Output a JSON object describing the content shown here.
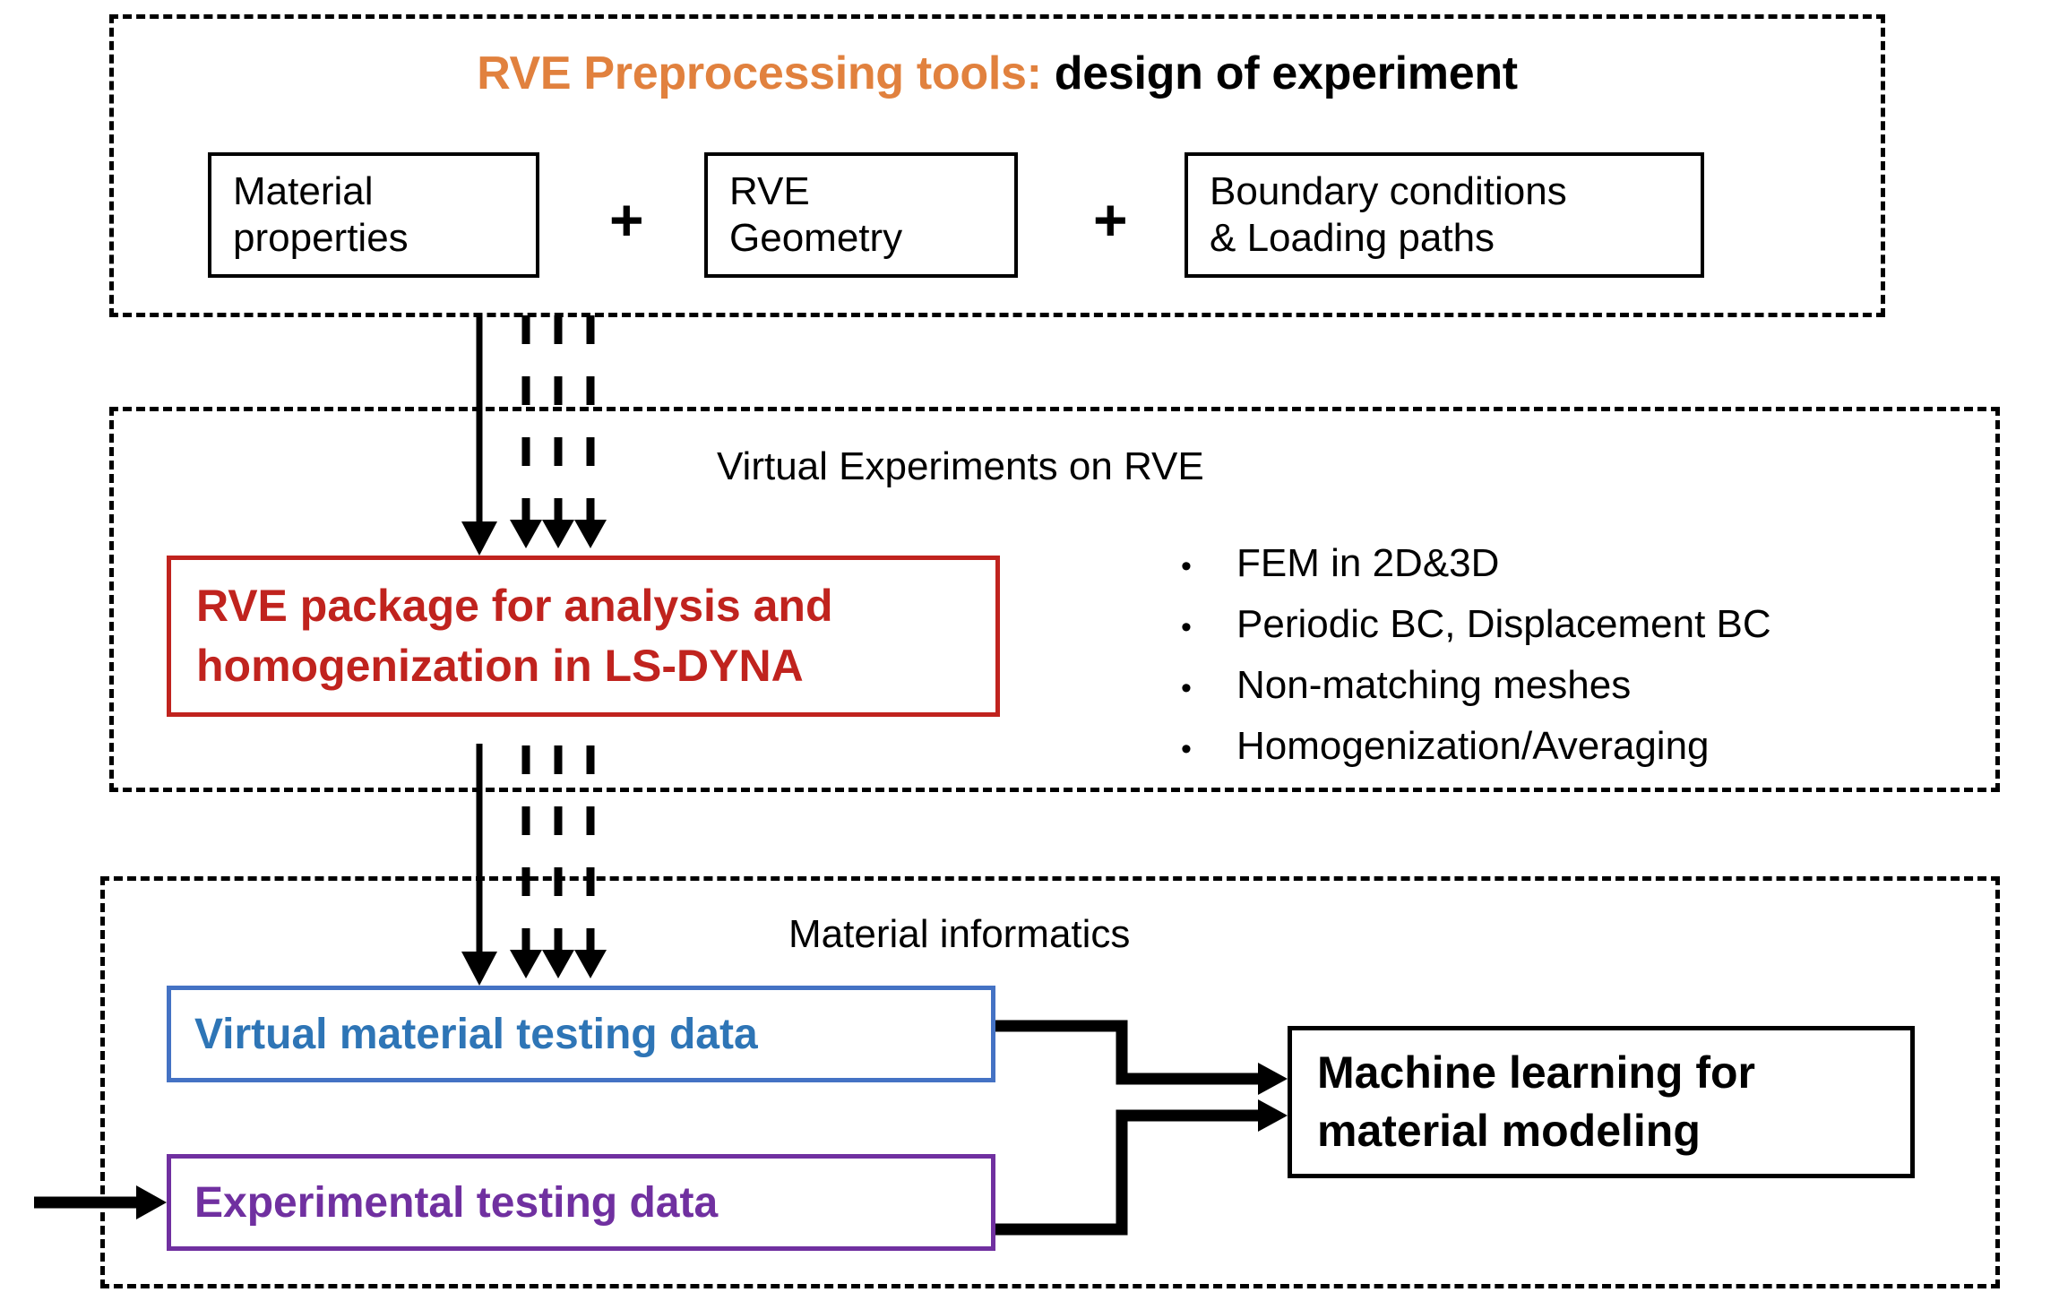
{
  "sections": {
    "preprocessing": {
      "title_accent": "RVE Preprocessing tools:",
      "title_rest": " design of experiment",
      "boxes": [
        {
          "name": "material-properties",
          "line1": "Material",
          "line2": "properties"
        },
        {
          "name": "rve-geometry",
          "line1": "RVE",
          "line2": "Geometry"
        },
        {
          "name": "boundary-conditions",
          "line1": "Boundary conditions",
          "line2": "& Loading paths"
        }
      ],
      "operators": [
        "+",
        "+"
      ]
    },
    "virtual_experiments": {
      "label": "Virtual Experiments on RVE",
      "package_box": {
        "line1": "RVE package for analysis and",
        "line2": "homogenization in LS-DYNA",
        "color": "#C0231E"
      },
      "bullets": [
        "FEM in 2D&3D",
        "Periodic BC, Displacement BC",
        "Non-matching meshes",
        "Homogenization/Averaging"
      ],
      "bullet_glyph": "•"
    },
    "material_informatics": {
      "label": "Material informatics",
      "virtual_data_box": {
        "text": "Virtual material testing data",
        "color": "#2E75B6"
      },
      "experimental_data_box": {
        "text": "Experimental testing data",
        "color": "#7030A0"
      },
      "machine_learning_box": {
        "line1": "Machine learning for",
        "line2": "material modeling",
        "color": "#000000"
      }
    }
  },
  "colors": {
    "accent_orange": "#E1813E",
    "red": "#C0231E",
    "blue": "#4472C4",
    "blue_text": "#2E75B6",
    "purple": "#7030A0",
    "black": "#000000"
  }
}
